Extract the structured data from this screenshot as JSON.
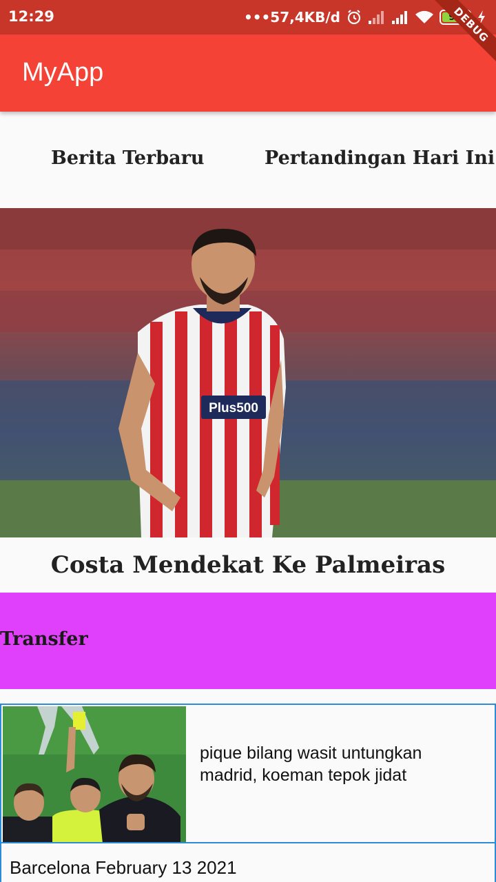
{
  "status_bar": {
    "time": "12:29",
    "net_speed": "•••57,4KB/d",
    "battery_level": "93",
    "icons": [
      "alarm-icon",
      "signal-icon",
      "signal-icon",
      "wifi-icon",
      "battery-icon",
      "charging-icon"
    ]
  },
  "debug_banner": "DEBUG",
  "app_bar": {
    "title": "MyApp",
    "color": "#f44336"
  },
  "tabs": [
    {
      "label": "Berita Terbaru"
    },
    {
      "label": "Pertandingan Hari Ini"
    }
  ],
  "featured": {
    "image": "player-photo",
    "title": "Costa Mendekat Ke Palmeiras"
  },
  "category": {
    "label": "Transfer",
    "color": "#e040fb"
  },
  "news": [
    {
      "image": "referee-yellow-card-photo",
      "title": "pique bilang wasit untungkan madrid, koeman tepok jidat",
      "meta": "Barcelona February 13 2021"
    }
  ]
}
